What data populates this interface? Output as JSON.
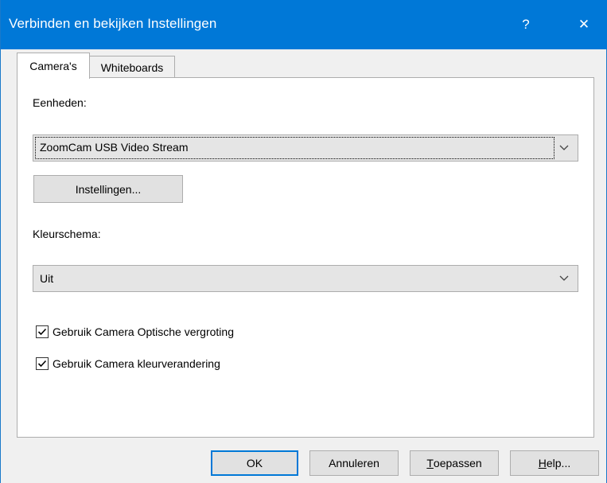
{
  "window": {
    "title": "Verbinden en bekijken Instellingen",
    "help_glyph": "?",
    "close_glyph": "✕"
  },
  "tabs": [
    {
      "label": "Camera's",
      "active": true
    },
    {
      "label": "Whiteboards",
      "active": false
    }
  ],
  "devices": {
    "label": "Eenheden:",
    "selected": "ZoomCam USB Video Stream"
  },
  "settings_button": "Instellingen...",
  "color_scheme": {
    "label": "Kleurschema:",
    "selected": "Uit"
  },
  "checkboxes": [
    {
      "label": "Gebruik Camera Optische vergroting",
      "checked": true
    },
    {
      "label": "Gebruik Camera kleurverandering",
      "checked": true
    }
  ],
  "buttons": {
    "ok": "OK",
    "cancel": "Annuleren",
    "apply_mnemonic": "T",
    "apply_rest": "oepassen",
    "help_mnemonic": "H",
    "help_rest": "elp..."
  },
  "colors": {
    "titlebar": "#0078d7",
    "default_button_border": "#0078d7"
  }
}
